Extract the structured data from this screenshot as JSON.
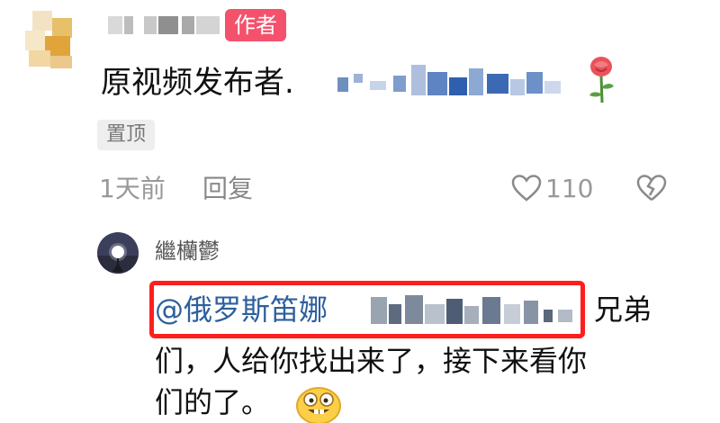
{
  "comment": {
    "author_badge": "作者",
    "text": "原视频发布者.",
    "pin_tag": "置顶",
    "time": "1天前",
    "reply_label": "回复",
    "like_count": "110",
    "decor_icon": "rose-icon"
  },
  "reply": {
    "username": "繼欗鬱",
    "mention": "@俄罗斯笛娜",
    "line1_tail": "兄弟",
    "line2": "们，人给你找出来了，接下来看你",
    "line3": "们的了。",
    "emoji_icon": "grin-emoji-icon"
  },
  "colors": {
    "badge": "#f4516c",
    "mention": "#2d5f9e",
    "highlight_box": "#ff1e1e"
  }
}
